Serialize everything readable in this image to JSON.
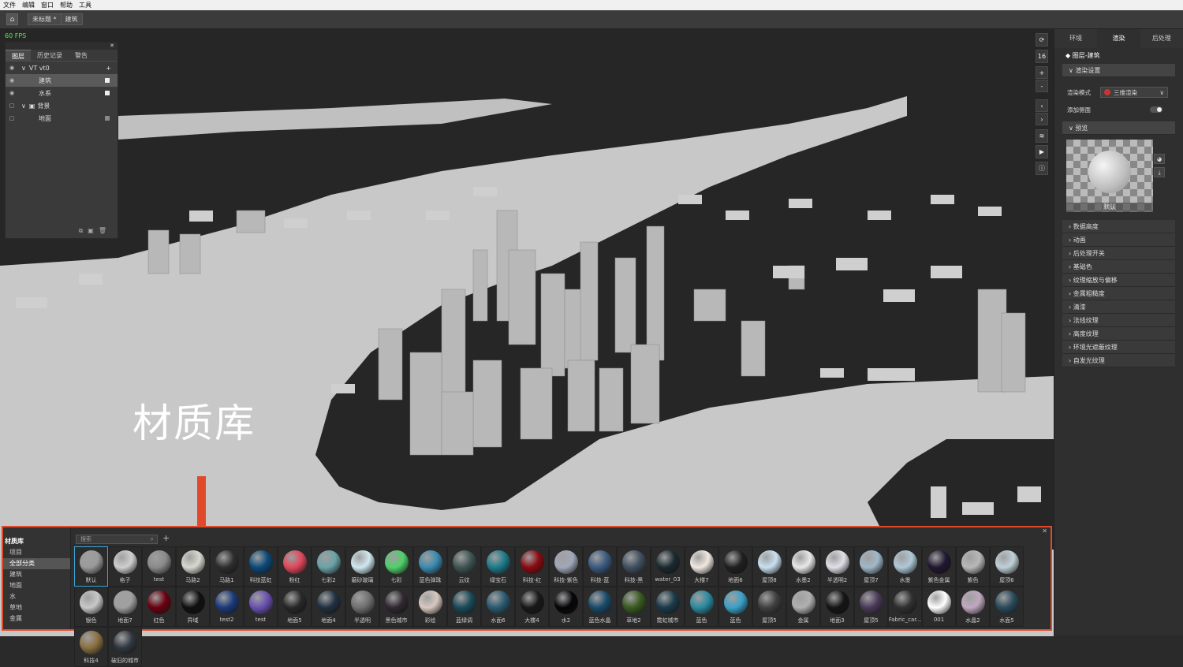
{
  "menu": [
    "文件",
    "编辑",
    "窗口",
    "帮助",
    "工具"
  ],
  "tabs": {
    "doc": "未标题 *",
    "scene": "建筑"
  },
  "viewport": {
    "fps": "60 FPS",
    "annotation": "材质库"
  },
  "layers": {
    "tabs": [
      "图层",
      "历史记录",
      "警告"
    ],
    "rows": [
      {
        "label": "VT vt0"
      },
      {
        "label": "建筑"
      },
      {
        "label": "水系"
      },
      {
        "label": "背景"
      },
      {
        "label": "地面"
      }
    ]
  },
  "view_tools": [
    "⟳",
    "16",
    "+",
    "-",
    "‹",
    "›",
    "≋",
    "▶",
    "ⓘ"
  ],
  "right_panel": {
    "tabs": [
      "环境",
      "渲染",
      "后处理"
    ],
    "title": "图层-建筑",
    "render_settings": "渲染设置",
    "render_mode_label": "渲染模式",
    "render_mode_value": "三维渲染",
    "add_side_label": "添加侧面",
    "preview_label": "预览",
    "preview_caption": "默认",
    "sections": [
      "数据高度",
      "动画",
      "后处理开关",
      "基础色",
      "纹理缩放与偏移",
      "金属粗糙度",
      "清漆",
      "法线纹理",
      "高度纹理",
      "环境光遮蔽纹理",
      "自发光纹理"
    ]
  },
  "material_library": {
    "title": "材质库",
    "categories": [
      "项目",
      "全部分类",
      "建筑",
      "地面",
      "水",
      "草地",
      "金属"
    ],
    "search_placeholder": "搜索",
    "row1": [
      {
        "name": "默认",
        "color": "#9a9a9a"
      },
      {
        "name": "格子",
        "color": "#cfcfcf"
      },
      {
        "name": "test",
        "color": "#8a8a8a"
      },
      {
        "name": "马路2",
        "color": "#d8d8d0"
      },
      {
        "name": "马路1",
        "color": "#2e2e2e"
      },
      {
        "name": "科技蓝虹",
        "color": "#0c4a7a"
      },
      {
        "name": "粉红",
        "color": "#e0475a"
      },
      {
        "name": "七彩2",
        "color": "#6aa3a8"
      },
      {
        "name": "磨砂玻璃",
        "color": "#cfe8f0"
      },
      {
        "name": "七彩",
        "color": "#4fd06a"
      },
      {
        "name": "蓝色弹珠",
        "color": "#3a8ab0"
      },
      {
        "name": "云纹",
        "color": "#3e5553"
      },
      {
        "name": "绿宝石",
        "color": "#1c7a8a"
      },
      {
        "name": "科技-红",
        "color": "#8a0a10"
      },
      {
        "name": "科技-紫色",
        "color": "#a0a8b8"
      },
      {
        "name": "科技-蓝",
        "color": "#3a5a80"
      },
      {
        "name": "科技-黑",
        "color": "#405060"
      },
      {
        "name": "water_03",
        "color": "#1a2a30"
      },
      {
        "name": "大楼7",
        "color": "#f0e8e0"
      },
      {
        "name": "地面6",
        "color": "#202020"
      },
      {
        "name": "屋顶8",
        "color": "#c8e0f0"
      },
      {
        "name": "水墨2",
        "color": "#e8e8e8"
      },
      {
        "name": "半透明2",
        "color": "#e0e0e8"
      },
      {
        "name": "屋顶7",
        "color": "#a0b8c8"
      },
      {
        "name": "水墨",
        "color": "#b0c8d8"
      },
      {
        "name": "紫色金属",
        "color": "#201830"
      },
      {
        "name": "紫色",
        "color": "#b8b8b8"
      },
      {
        "name": "屋顶6",
        "color": "#c0d0d8"
      },
      {
        "name": "银色",
        "color": "#c8c8c8"
      }
    ],
    "row2": [
      {
        "name": "地面7",
        "color": "#a0a0a0"
      },
      {
        "name": "红色",
        "color": "#6a0010"
      },
      {
        "name": "异域",
        "color": "#101010"
      },
      {
        "name": "test2",
        "color": "#1a3a7a"
      },
      {
        "name": "test",
        "color": "#6a50b0"
      },
      {
        "name": "地面5",
        "color": "#282828"
      },
      {
        "name": "地面4",
        "color": "#203040"
      },
      {
        "name": "半透明",
        "color": "#707070"
      },
      {
        "name": "黑色城市",
        "color": "#302830"
      },
      {
        "name": "彩绘",
        "color": "#d8c8c0"
      },
      {
        "name": "蓝绿调",
        "color": "#1a4a5a"
      },
      {
        "name": "水面6",
        "color": "#2a5a70"
      },
      {
        "name": "大楼4",
        "color": "#181818"
      },
      {
        "name": "水2",
        "color": "#050508"
      },
      {
        "name": "蓝色水晶",
        "color": "#1a4a6a"
      },
      {
        "name": "草地2",
        "color": "#3a5a20"
      },
      {
        "name": "霓虹城市",
        "color": "#1a3a4a"
      },
      {
        "name": "蓝色",
        "color": "#2a8aa0"
      },
      {
        "name": "蓝色",
        "color": "#3aa0c8"
      },
      {
        "name": "屋顶5",
        "color": "#404040"
      },
      {
        "name": "金属",
        "color": "#b0b0b0"
      },
      {
        "name": "地面3",
        "color": "#151515"
      },
      {
        "name": "屋顶5",
        "color": "#4a3a5a"
      },
      {
        "name": "Fabric_car...",
        "color": "#303030"
      },
      {
        "name": "001",
        "color": "#ffffff"
      },
      {
        "name": "水晶2",
        "color": "#c0a8c0"
      },
      {
        "name": "水面5",
        "color": "#2a4a5a"
      },
      {
        "name": "科技4",
        "color": "#8a7040"
      },
      {
        "name": "破旧的城市",
        "color": "#303840"
      }
    ]
  }
}
